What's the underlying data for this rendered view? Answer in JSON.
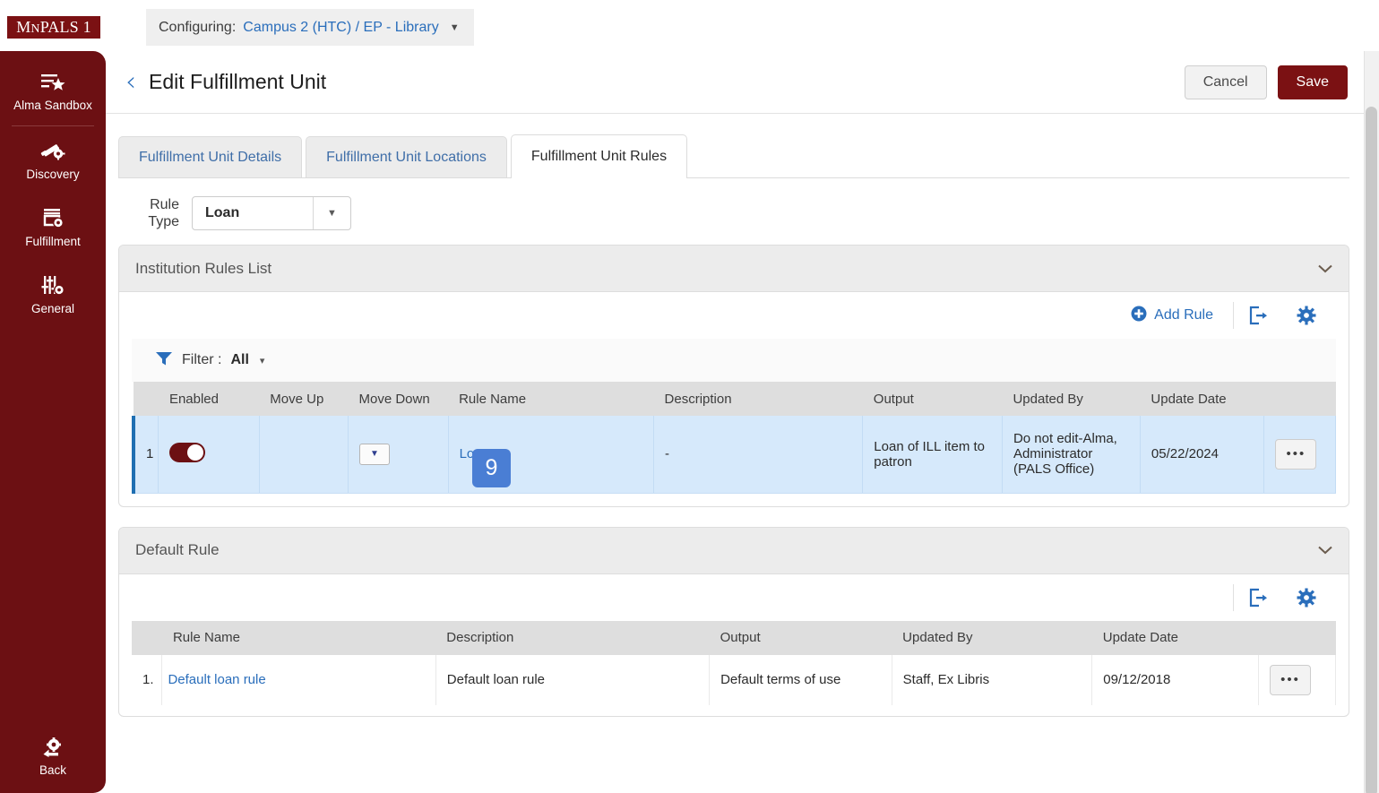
{
  "topbar": {
    "logo_main": "M",
    "logo_small": "N",
    "logo_rest": "PALS 1",
    "configuring_label": "Configuring:",
    "configuring_value": "Campus 2 (HTC) / EP - Library",
    "caret": "▼"
  },
  "sidebar": {
    "app_label": "Alma Sandbox",
    "items": [
      {
        "label": "Discovery",
        "icon": "telescope-icon"
      },
      {
        "label": "Fulfillment",
        "icon": "fulfillment-icon"
      },
      {
        "label": "General",
        "icon": "sliders-icon"
      }
    ],
    "back_label": "Back"
  },
  "header": {
    "back_chevron": "‹",
    "title": "Edit Fulfillment Unit",
    "cancel_label": "Cancel",
    "save_label": "Save"
  },
  "tabs": [
    {
      "label": "Fulfillment Unit Details",
      "active": false
    },
    {
      "label": "Fulfillment Unit Locations",
      "active": false
    },
    {
      "label": "Fulfillment Unit Rules",
      "active": true
    }
  ],
  "rule_type": {
    "label_line1": "Rule",
    "label_line2": "Type",
    "value": "Loan",
    "caret": "▼"
  },
  "institution_section": {
    "title": "Institution Rules List",
    "collapse_caret": "⌄",
    "add_rule_label": "Add Rule",
    "add_icon": "plus-circle-icon",
    "export_icon": "export-icon",
    "settings_icon": "gear-icon",
    "filter_label": "Filter :",
    "filter_value": "All",
    "filter_caret": "▾",
    "columns": [
      "",
      "Enabled",
      "Move Up",
      "Move Down",
      "Rule Name",
      "Description",
      "Output",
      "Updated By",
      "Update Date",
      ""
    ],
    "rows": [
      {
        "index": "1",
        "enabled": true,
        "move_up": "",
        "move_down_caret": "▼",
        "rule_name": "Loan",
        "description": "-",
        "output": "Loan of ILL item to patron",
        "updated_by": "Do not edit-Alma, Administrator (PALS Office)",
        "update_date": "05/22/2024",
        "actions": "•••"
      }
    ]
  },
  "default_section": {
    "title": "Default Rule",
    "collapse_caret": "⌄",
    "export_icon": "export-icon",
    "settings_icon": "gear-icon",
    "columns": [
      "",
      "Rule Name",
      "Description",
      "Output",
      "Updated By",
      "Update Date",
      ""
    ],
    "rows": [
      {
        "index": "1.",
        "rule_name": "Default loan rule",
        "description": "Default loan rule",
        "output": "Default terms of use",
        "updated_by": "Staff, Ex Libris",
        "update_date": "09/12/2018",
        "actions": "•••"
      }
    ]
  },
  "annotation": {
    "badge_number": "9"
  },
  "colors": {
    "brand_maroon": "#6c1013",
    "save_maroon": "#7b1113",
    "link_blue": "#2a6ebb",
    "row_highlight": "#d6e9fb",
    "row_accent": "#1f6fb2",
    "badge_blue": "#4a7ed4"
  }
}
